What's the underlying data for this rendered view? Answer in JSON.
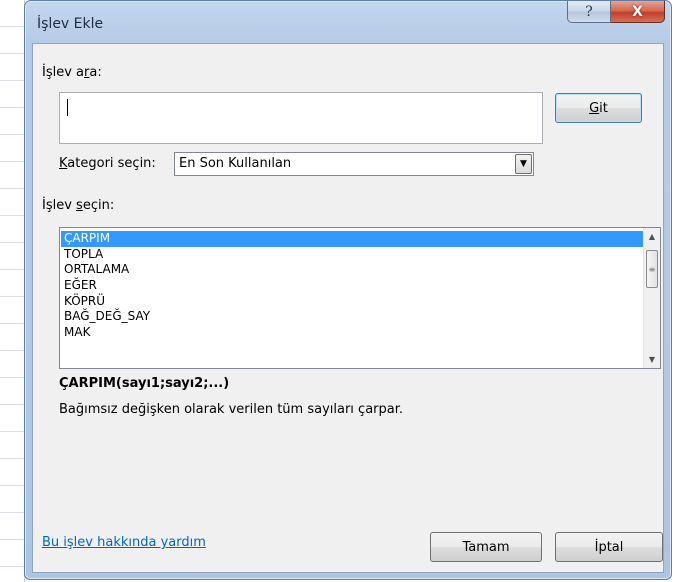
{
  "dialog": {
    "title": "İşlev Ekle",
    "help_glyph": "?",
    "close_glyph": "X"
  },
  "search": {
    "label_before": "İşlev a",
    "label_accel": "r",
    "label_after": "a:",
    "value": "",
    "go_button_accel": "G",
    "go_button_rest": "it"
  },
  "category": {
    "label_accel": "K",
    "label_rest": "ategori seçin:",
    "selected": "En Son Kullanılan",
    "arrow_glyph": "▼"
  },
  "function_list": {
    "label_before": "İşlev ",
    "label_accel": "s",
    "label_after": "eçin:",
    "items": [
      "ÇARPIM",
      "TOPLA",
      "ORTALAMA",
      "EĞER",
      "KÖPRÜ",
      "BAĞ_DEĞ_SAY",
      "MAK"
    ],
    "selected_index": 0,
    "scroll_up_glyph": "▲",
    "scroll_down_glyph": "▼",
    "thumb_grip": "≡"
  },
  "details": {
    "signature": "ÇARPIM(sayı1;sayı2;...)",
    "description": "Bağımsız değişken olarak verilen tüm sayıları çarpar."
  },
  "footer": {
    "help_link": "Bu işlev hakkında yardım",
    "ok_label": "Tamam",
    "cancel_label": "İptal"
  }
}
